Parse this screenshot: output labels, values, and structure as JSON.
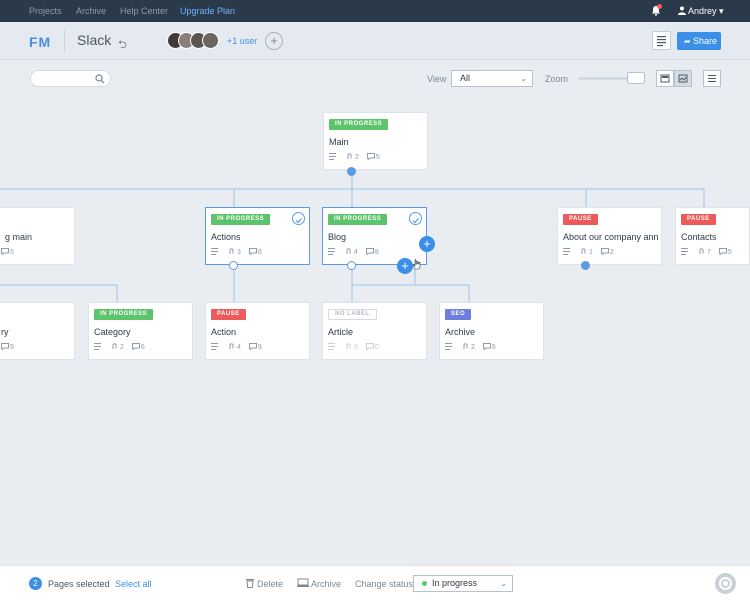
{
  "topnav": {
    "items": [
      "Projects",
      "Archive",
      "Help Center",
      "Upgrade Plan"
    ],
    "user": "Andrey ▾"
  },
  "project": {
    "logo": "FM",
    "title": "Slack",
    "extra_users": "+1 user",
    "share_label": "Share"
  },
  "toolbar": {
    "view_label": "View",
    "view_value": "All",
    "zoom_label": "Zoom",
    "zoom_level": 0.8
  },
  "cards": [
    {
      "id": "main",
      "badge": "IN PROGRESS",
      "title": "Main",
      "files": "2",
      "comments": "5"
    },
    {
      "id": "left-main",
      "title": "g main",
      "comments": "5"
    },
    {
      "id": "actions",
      "badge": "IN PROGRESS",
      "title": "Actions",
      "files": "3",
      "comments": "6"
    },
    {
      "id": "blog",
      "badge": "IN PROGRESS",
      "title": "Blog",
      "files": "4",
      "comments": "8"
    },
    {
      "id": "about",
      "badge": "PAUSE",
      "title": "About our company annu",
      "files": "1",
      "comments": "2"
    },
    {
      "id": "contacts",
      "badge": "PAUSE",
      "title": "Contacts",
      "files": "7",
      "comments": "5"
    },
    {
      "id": "left-row2",
      "title": "ry",
      "comments": "5"
    },
    {
      "id": "category",
      "badge": "IN PROGRESS",
      "title": "Category",
      "files": "2",
      "comments": "6"
    },
    {
      "id": "action",
      "badge": "PAUSE",
      "title": "Action",
      "files": "4",
      "comments": "9"
    },
    {
      "id": "article",
      "badge": "NO LABEL",
      "title": "Article",
      "files": "0",
      "comments": "0"
    },
    {
      "id": "archive",
      "badge": "SEO",
      "title": "Archive",
      "files": "2",
      "comments": "5"
    }
  ],
  "bottombar": {
    "count": "2",
    "selected_label": "Pages selected",
    "select_all": "Select all",
    "delete": "Delete",
    "archive": "Archive",
    "change_status": "Change status",
    "status_value": "In progress"
  },
  "colors": {
    "accent": "#3b8fe8",
    "in_progress": "#5cc46b",
    "pause": "#ec5a5a",
    "seo": "#6d7ee0"
  }
}
